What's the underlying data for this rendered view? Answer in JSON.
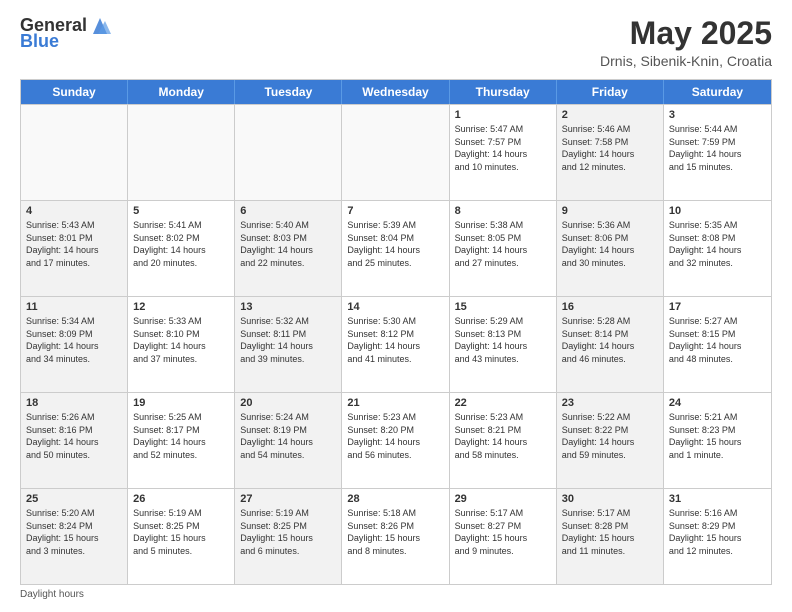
{
  "logo": {
    "general": "General",
    "blue": "Blue"
  },
  "header": {
    "month": "May 2025",
    "location": "Drnis, Sibenik-Knin, Croatia"
  },
  "days": [
    "Sunday",
    "Monday",
    "Tuesday",
    "Wednesday",
    "Thursday",
    "Friday",
    "Saturday"
  ],
  "footer": {
    "note": "Daylight hours"
  },
  "rows": [
    [
      {
        "day": "",
        "text": "",
        "empty": true
      },
      {
        "day": "",
        "text": "",
        "empty": true
      },
      {
        "day": "",
        "text": "",
        "empty": true
      },
      {
        "day": "",
        "text": "",
        "empty": true
      },
      {
        "day": "1",
        "text": "Sunrise: 5:47 AM\nSunset: 7:57 PM\nDaylight: 14 hours\nand 10 minutes.",
        "shaded": false
      },
      {
        "day": "2",
        "text": "Sunrise: 5:46 AM\nSunset: 7:58 PM\nDaylight: 14 hours\nand 12 minutes.",
        "shaded": true
      },
      {
        "day": "3",
        "text": "Sunrise: 5:44 AM\nSunset: 7:59 PM\nDaylight: 14 hours\nand 15 minutes.",
        "shaded": false
      }
    ],
    [
      {
        "day": "4",
        "text": "Sunrise: 5:43 AM\nSunset: 8:01 PM\nDaylight: 14 hours\nand 17 minutes.",
        "shaded": true
      },
      {
        "day": "5",
        "text": "Sunrise: 5:41 AM\nSunset: 8:02 PM\nDaylight: 14 hours\nand 20 minutes.",
        "shaded": false
      },
      {
        "day": "6",
        "text": "Sunrise: 5:40 AM\nSunset: 8:03 PM\nDaylight: 14 hours\nand 22 minutes.",
        "shaded": true
      },
      {
        "day": "7",
        "text": "Sunrise: 5:39 AM\nSunset: 8:04 PM\nDaylight: 14 hours\nand 25 minutes.",
        "shaded": false
      },
      {
        "day": "8",
        "text": "Sunrise: 5:38 AM\nSunset: 8:05 PM\nDaylight: 14 hours\nand 27 minutes.",
        "shaded": false
      },
      {
        "day": "9",
        "text": "Sunrise: 5:36 AM\nSunset: 8:06 PM\nDaylight: 14 hours\nand 30 minutes.",
        "shaded": true
      },
      {
        "day": "10",
        "text": "Sunrise: 5:35 AM\nSunset: 8:08 PM\nDaylight: 14 hours\nand 32 minutes.",
        "shaded": false
      }
    ],
    [
      {
        "day": "11",
        "text": "Sunrise: 5:34 AM\nSunset: 8:09 PM\nDaylight: 14 hours\nand 34 minutes.",
        "shaded": true
      },
      {
        "day": "12",
        "text": "Sunrise: 5:33 AM\nSunset: 8:10 PM\nDaylight: 14 hours\nand 37 minutes.",
        "shaded": false
      },
      {
        "day": "13",
        "text": "Sunrise: 5:32 AM\nSunset: 8:11 PM\nDaylight: 14 hours\nand 39 minutes.",
        "shaded": true
      },
      {
        "day": "14",
        "text": "Sunrise: 5:30 AM\nSunset: 8:12 PM\nDaylight: 14 hours\nand 41 minutes.",
        "shaded": false
      },
      {
        "day": "15",
        "text": "Sunrise: 5:29 AM\nSunset: 8:13 PM\nDaylight: 14 hours\nand 43 minutes.",
        "shaded": false
      },
      {
        "day": "16",
        "text": "Sunrise: 5:28 AM\nSunset: 8:14 PM\nDaylight: 14 hours\nand 46 minutes.",
        "shaded": true
      },
      {
        "day": "17",
        "text": "Sunrise: 5:27 AM\nSunset: 8:15 PM\nDaylight: 14 hours\nand 48 minutes.",
        "shaded": false
      }
    ],
    [
      {
        "day": "18",
        "text": "Sunrise: 5:26 AM\nSunset: 8:16 PM\nDaylight: 14 hours\nand 50 minutes.",
        "shaded": true
      },
      {
        "day": "19",
        "text": "Sunrise: 5:25 AM\nSunset: 8:17 PM\nDaylight: 14 hours\nand 52 minutes.",
        "shaded": false
      },
      {
        "day": "20",
        "text": "Sunrise: 5:24 AM\nSunset: 8:19 PM\nDaylight: 14 hours\nand 54 minutes.",
        "shaded": true
      },
      {
        "day": "21",
        "text": "Sunrise: 5:23 AM\nSunset: 8:20 PM\nDaylight: 14 hours\nand 56 minutes.",
        "shaded": false
      },
      {
        "day": "22",
        "text": "Sunrise: 5:23 AM\nSunset: 8:21 PM\nDaylight: 14 hours\nand 58 minutes.",
        "shaded": false
      },
      {
        "day": "23",
        "text": "Sunrise: 5:22 AM\nSunset: 8:22 PM\nDaylight: 14 hours\nand 59 minutes.",
        "shaded": true
      },
      {
        "day": "24",
        "text": "Sunrise: 5:21 AM\nSunset: 8:23 PM\nDaylight: 15 hours\nand 1 minute.",
        "shaded": false
      }
    ],
    [
      {
        "day": "25",
        "text": "Sunrise: 5:20 AM\nSunset: 8:24 PM\nDaylight: 15 hours\nand 3 minutes.",
        "shaded": true
      },
      {
        "day": "26",
        "text": "Sunrise: 5:19 AM\nSunset: 8:25 PM\nDaylight: 15 hours\nand 5 minutes.",
        "shaded": false
      },
      {
        "day": "27",
        "text": "Sunrise: 5:19 AM\nSunset: 8:25 PM\nDaylight: 15 hours\nand 6 minutes.",
        "shaded": true
      },
      {
        "day": "28",
        "text": "Sunrise: 5:18 AM\nSunset: 8:26 PM\nDaylight: 15 hours\nand 8 minutes.",
        "shaded": false
      },
      {
        "day": "29",
        "text": "Sunrise: 5:17 AM\nSunset: 8:27 PM\nDaylight: 15 hours\nand 9 minutes.",
        "shaded": false
      },
      {
        "day": "30",
        "text": "Sunrise: 5:17 AM\nSunset: 8:28 PM\nDaylight: 15 hours\nand 11 minutes.",
        "shaded": true
      },
      {
        "day": "31",
        "text": "Sunrise: 5:16 AM\nSunset: 8:29 PM\nDaylight: 15 hours\nand 12 minutes.",
        "shaded": false
      }
    ]
  ]
}
